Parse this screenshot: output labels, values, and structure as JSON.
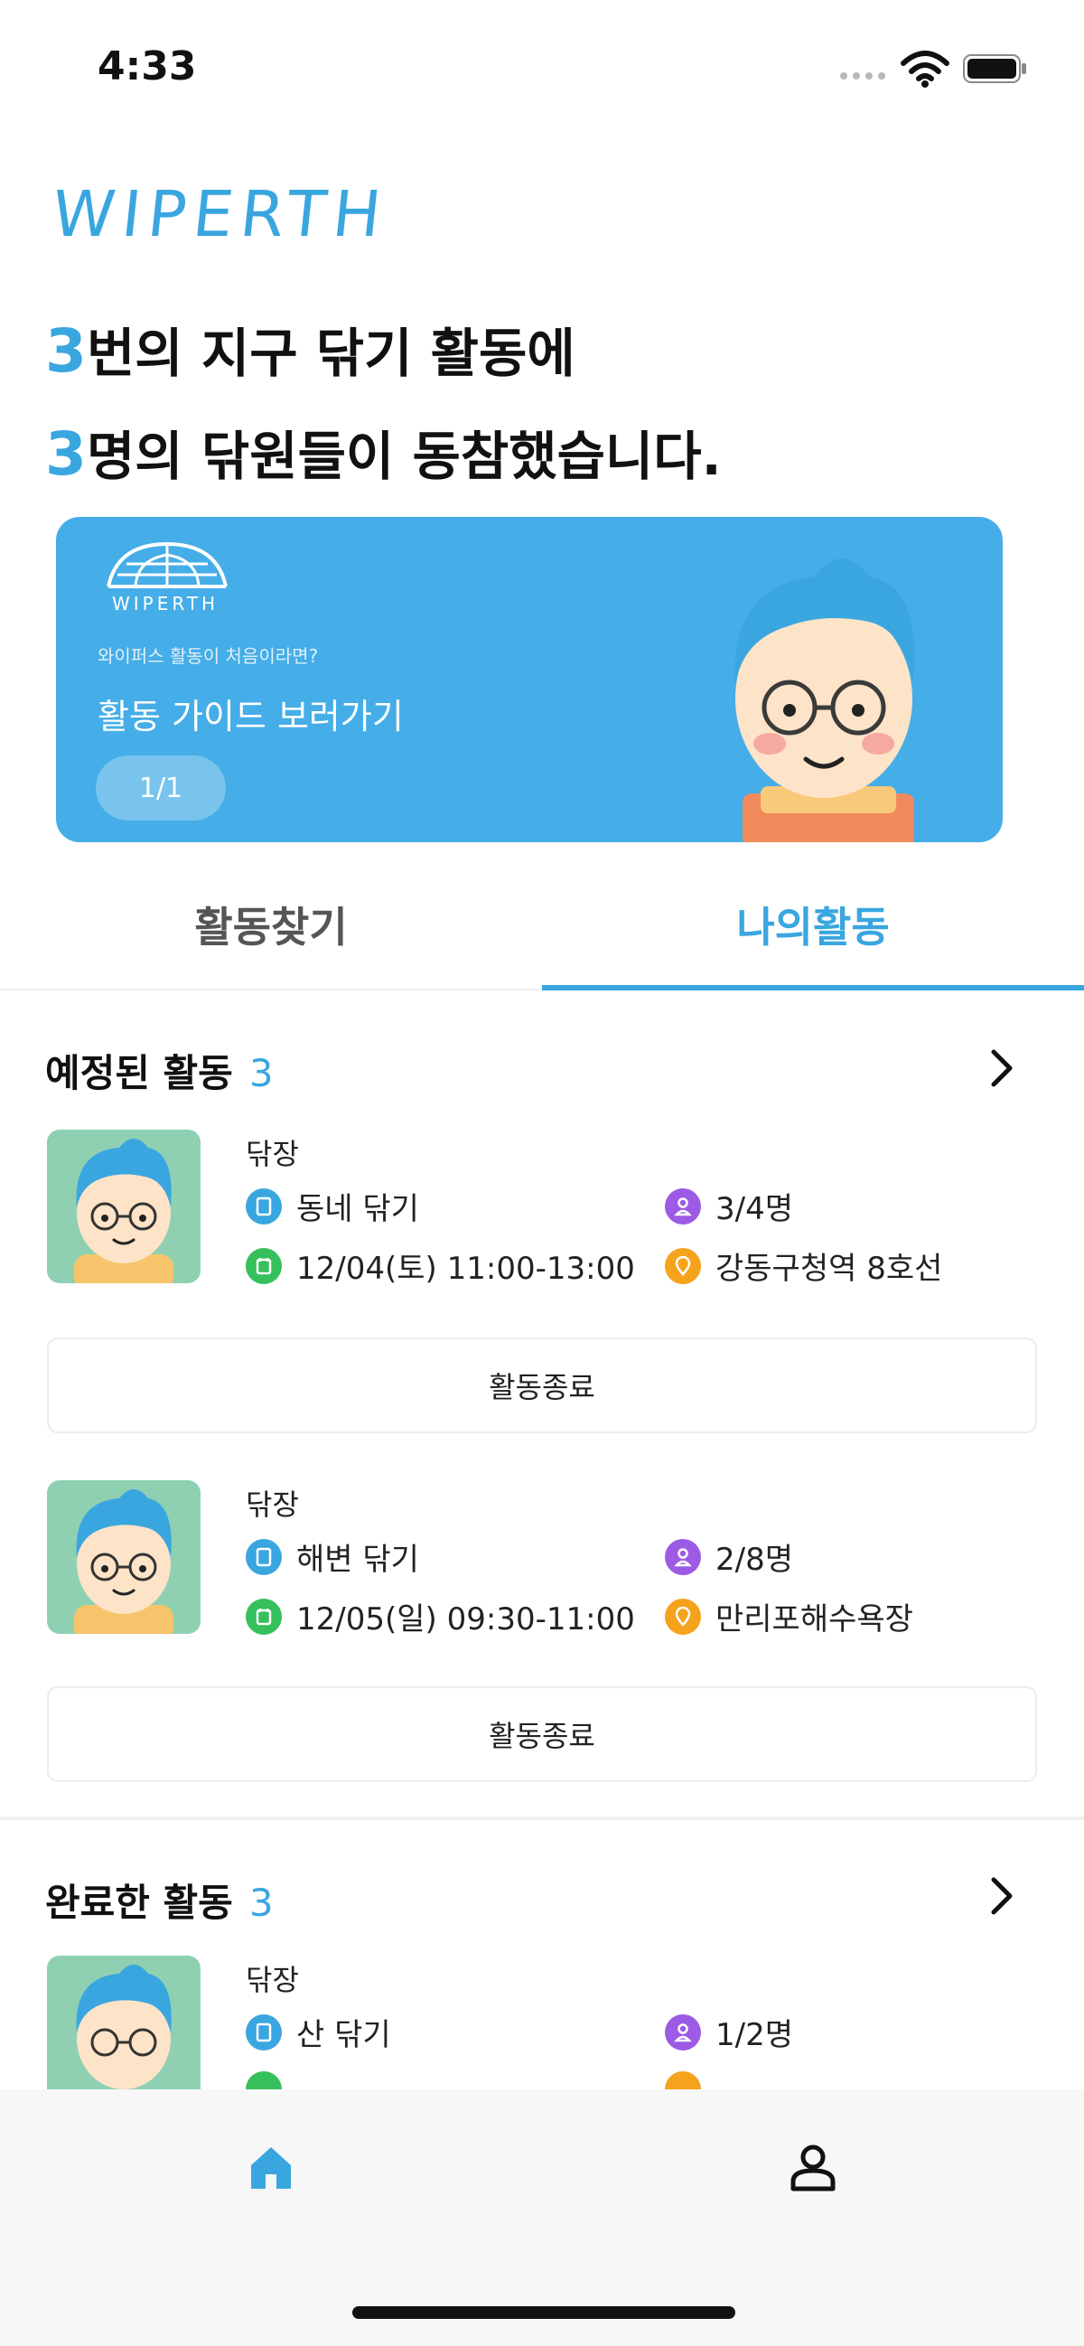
{
  "status_bar": {
    "time": "4:33"
  },
  "app": {
    "logo": "WIPERTH"
  },
  "summary": {
    "line1_count": "3",
    "line1_text": "번의 지구 닦기 활동에",
    "line2_count": "3",
    "line2_text": "명의 닦원들이 동참했습니다."
  },
  "banner": {
    "logo_text": "WIPERTH",
    "subtitle": "와이퍼스 활동이 처음이라면?",
    "title": "활동 가이드 보러가기",
    "page_indicator": "1/1",
    "accent": "#45ade7"
  },
  "tabs": [
    {
      "label": "활동찾기",
      "active": false
    },
    {
      "label": "나의활동",
      "active": true
    }
  ],
  "scheduled": {
    "title": "예정된 활동",
    "count": "3",
    "items": [
      {
        "role": "닦장",
        "activity": "동네 닦기",
        "participants": "3/4명",
        "datetime": "12/04(토) 11:00-13:00",
        "location": "강동구청역 8호선",
        "button": "활동종료"
      },
      {
        "role": "닦장",
        "activity": "해변 닦기",
        "participants": "2/8명",
        "datetime": "12/05(일) 09:30-11:00",
        "location": "만리포해수욕장",
        "button": "활동종료"
      }
    ]
  },
  "completed": {
    "title": "완료한 활동",
    "count": "3",
    "items": [
      {
        "role": "닦장",
        "activity": "산 닦기",
        "participants": "1/2명"
      }
    ]
  },
  "bottom_nav": [
    {
      "icon": "home-icon",
      "active": true
    },
    {
      "icon": "profile-icon",
      "active": false
    }
  ],
  "colors": {
    "primary": "#3aa6e0",
    "icon_blue": "#3aa6e0",
    "icon_green": "#35c05b",
    "icon_purple": "#9d5ae5",
    "icon_orange": "#f5a21d"
  }
}
